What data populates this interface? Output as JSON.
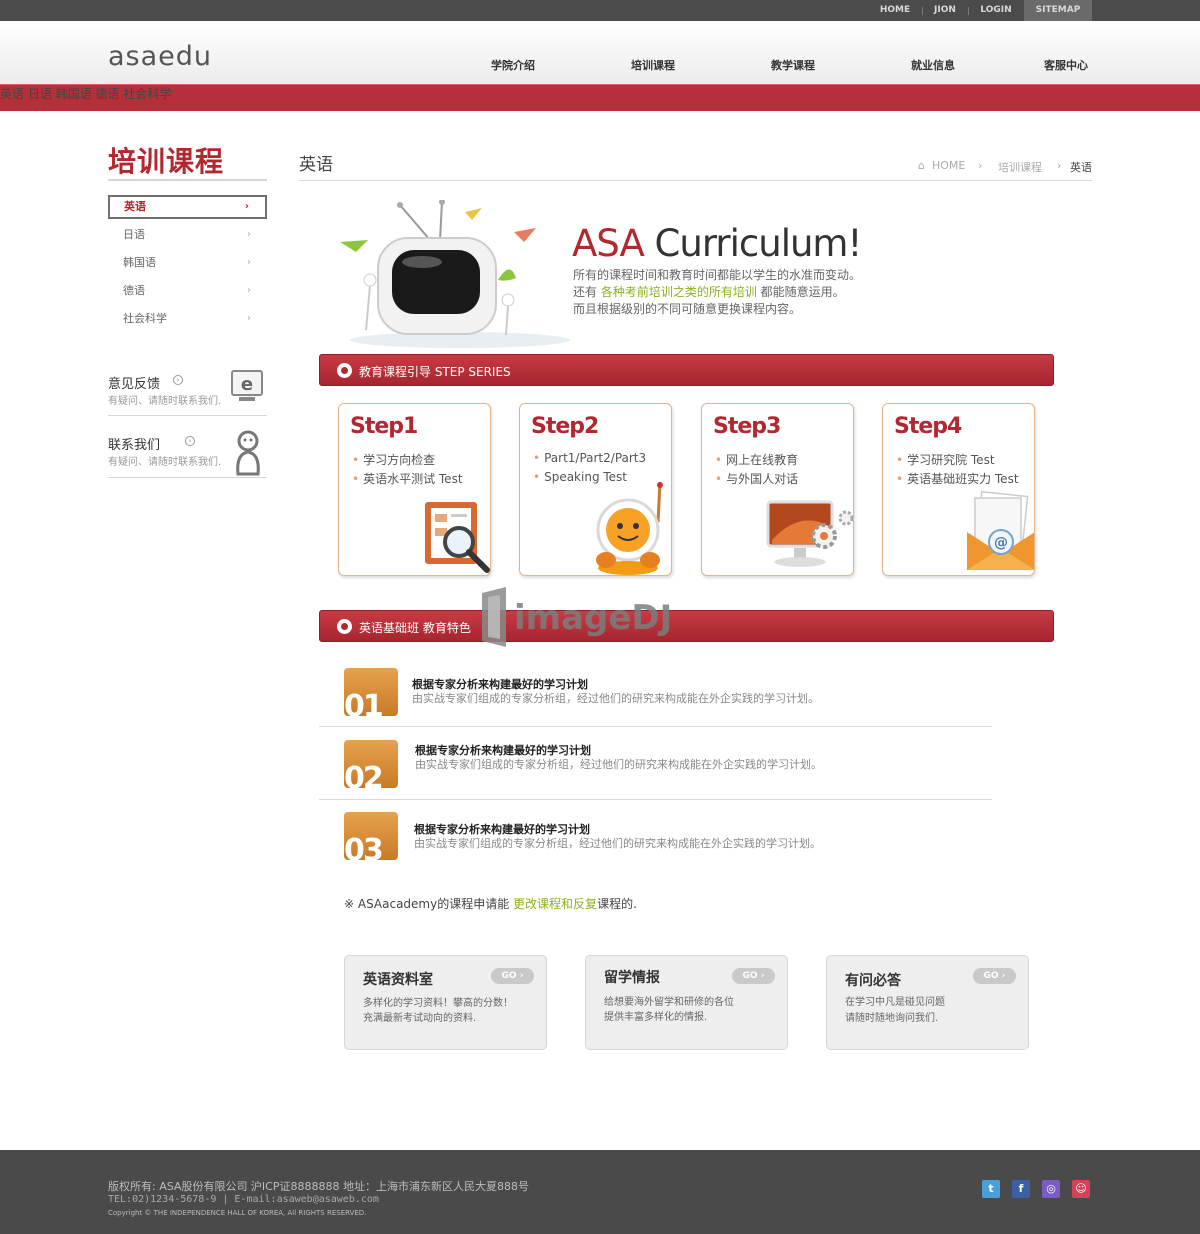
{
  "topbar": {
    "links": [
      "HOME",
      "JION",
      "LOGIN",
      "SITEMAP"
    ]
  },
  "header": {
    "logo": "asaedu",
    "gnb": [
      "学院介绍",
      "培训课程",
      "教学课程",
      "就业信息",
      "客服中心"
    ],
    "subnav": [
      "英语",
      "日语",
      "韩国语",
      "德语",
      "社会科学"
    ]
  },
  "sidebar": {
    "title": "培训课程",
    "items": [
      {
        "label": "英语",
        "arrow": "›"
      },
      {
        "label": "日语",
        "arrow": "›"
      },
      {
        "label": "韩国语",
        "arrow": "›"
      },
      {
        "label": "德语",
        "arrow": "›"
      },
      {
        "label": "社会科学",
        "arrow": "›"
      }
    ],
    "feedback": {
      "title": "意见反馈",
      "desc": "有疑问、请随时联系我们.",
      "icon_letter": "e"
    },
    "contact": {
      "title": "联系我们",
      "desc": "有疑问、请随时联系我们."
    }
  },
  "main": {
    "page_title": "英语",
    "breadcrumb": [
      "HOME",
      "培训课程",
      "英语"
    ],
    "hero": {
      "title_a": "ASA",
      "title_b": " Curriculum!",
      "line1": "所有的课程时间和教育时间都能以学生的水准而变动。",
      "line2_pre": "还有 ",
      "line2_hl": "各种考前培训之类的所有培训",
      "line2_post": " 都能随意运用。",
      "line3": "而且根据级别的不同可随意更换课程内容。"
    },
    "band1": "教育课程引导   STEP   SERIES",
    "steps": [
      {
        "title": "Step1",
        "items": [
          "学习方向检查",
          "英语水平测试 Test"
        ]
      },
      {
        "title": "Step2",
        "items": [
          "Part1/Part2/Part3",
          "Speaking Test"
        ]
      },
      {
        "title": "Step3",
        "items": [
          "网上在线教育",
          "与外国人对话"
        ]
      },
      {
        "title": "Step4",
        "items": [
          "学习研究院 Test",
          "英语基础班实力 Test"
        ]
      }
    ],
    "band2": "英语基础班 教育特色",
    "features": [
      {
        "num": "01",
        "title": "根据专家分析来构建最好的学习计划",
        "desc": "由实战专家们组成的专家分析组，经过他们的研究来构成能在外企实践的学习计划。"
      },
      {
        "num": "02",
        "title": "根据专家分析来构建最好的学习计划",
        "desc": "由实战专家们组成的专家分析组，经过他们的研究来构成能在外企实践的学习计划。"
      },
      {
        "num": "03",
        "title": "根据专家分析来构建最好的学习计划",
        "desc": "由实战专家们组成的专家分析组，经过他们的研究来构成能在外企实践的学习计划。"
      }
    ],
    "notice": {
      "pre": "※  ASAacademy的课程申请能 ",
      "hl": "更改课程和反复",
      "post": "课程的."
    },
    "cards": [
      {
        "title": "英语资料室",
        "go": "GO ›",
        "lines": [
          "多样化的学习资料！攀高的分数！",
          "充满最新考试动向的资料."
        ]
      },
      {
        "title": "留学情报",
        "go": "GO ›",
        "lines": [
          "给想要海外留学和研修的各位",
          "提供丰富多样化的情报."
        ]
      },
      {
        "title": "有问必答",
        "go": "GO ›",
        "lines": [
          "在学习中凡是碰见问题",
          "请随时随地询问我们."
        ]
      }
    ]
  },
  "watermark": "imageDJ",
  "footer": {
    "line1": "版权所有: ASA股份有限公司 沪ICP证8888888 地址：上海市浦东新区人民大夏888号",
    "line2": "TEL:02)1234-5678-9 | E-mail:asaweb@asaweb.com",
    "line3": "Copyright © THE INDEPENDENCE HALL OF KOREA, All RIGHTS RESERVED.",
    "social": [
      {
        "icon": "twitter-icon",
        "glyph": "t",
        "color": "#4a9fd8"
      },
      {
        "icon": "facebook-icon",
        "glyph": "f",
        "color": "#3b5fa6"
      },
      {
        "icon": "community-icon",
        "glyph": "◎",
        "color": "#7a5cc4"
      },
      {
        "icon": "blog-icon",
        "glyph": "☺",
        "color": "#d8405a"
      }
    ]
  }
}
